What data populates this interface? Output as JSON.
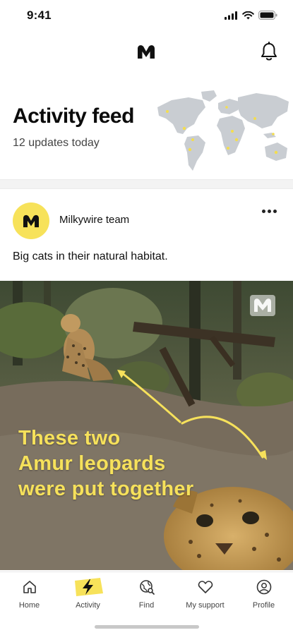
{
  "status_bar": {
    "time": "9:41"
  },
  "feed": {
    "title": "Activity feed",
    "subtitle": "12 updates today"
  },
  "post": {
    "author": "Milkywire team",
    "caption": "Big cats in their natural habitat.",
    "overlay_lines": [
      "These two",
      "Amur leopards",
      "were put together"
    ]
  },
  "tabs": [
    {
      "label": "Home",
      "icon": "home-icon",
      "active": false
    },
    {
      "label": "Activity",
      "icon": "lightning-icon",
      "active": true
    },
    {
      "label": "Find",
      "icon": "find-globe-icon",
      "active": false
    },
    {
      "label": "My support",
      "icon": "heart-icon",
      "active": false
    },
    {
      "label": "Profile",
      "icon": "profile-icon",
      "active": false
    }
  ],
  "colors": {
    "brand_yellow": "#f7e25a",
    "overlay_yellow": "#f6e15b",
    "text": "#111111"
  }
}
